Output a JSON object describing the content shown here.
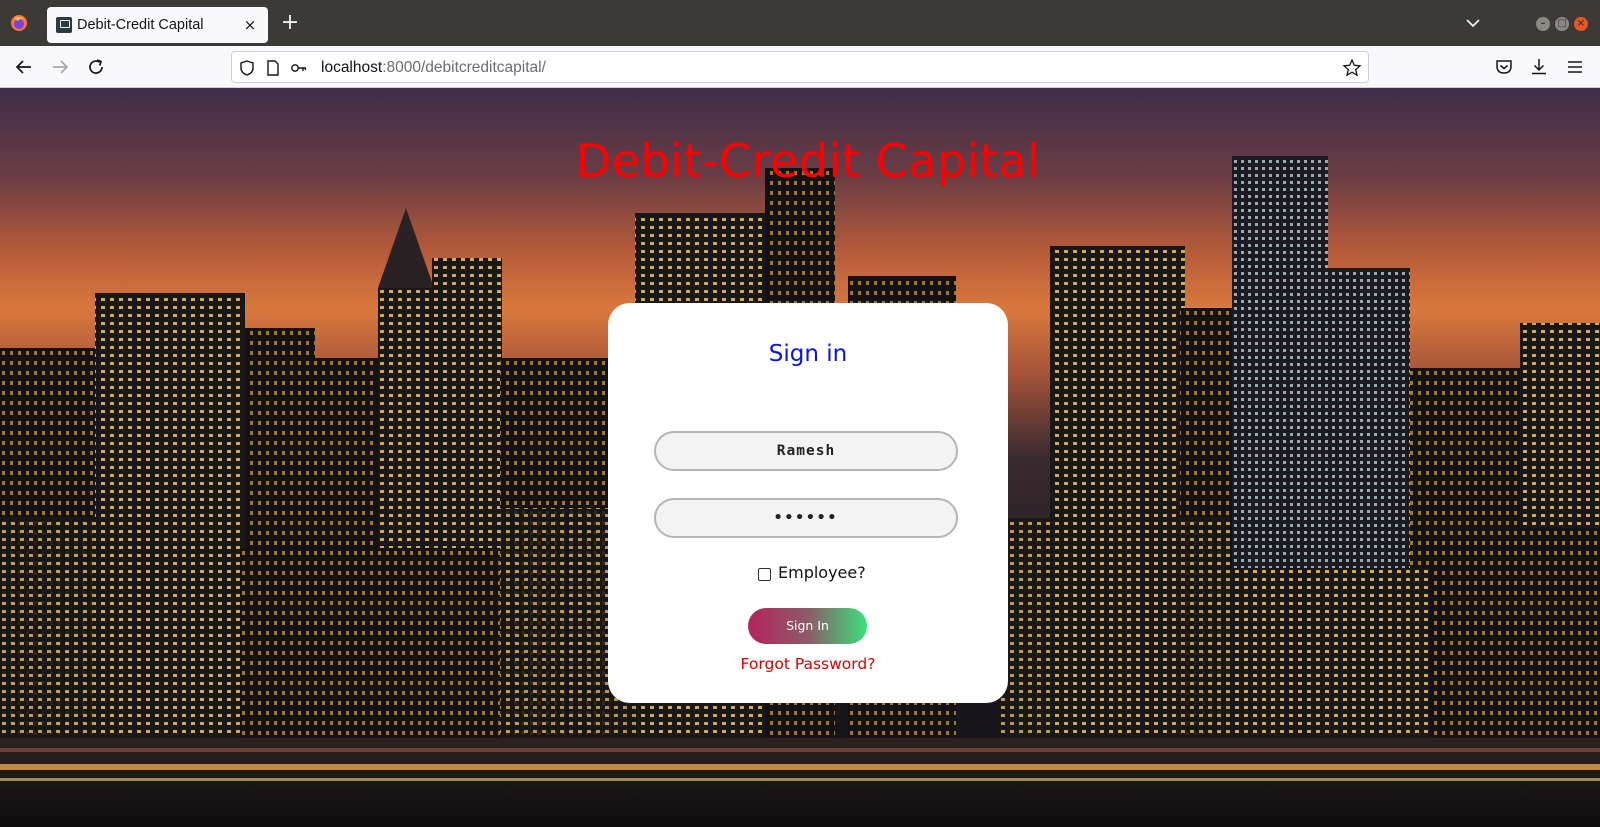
{
  "browser": {
    "tab_title": "Debit-Credit Capital",
    "url_host": "localhost",
    "url_path": ":8000/debitcreditcapital/",
    "tab_close": "×",
    "new_tab": "+"
  },
  "page": {
    "site_title": "Debit-Credit Capital",
    "signin_title": "Sign in",
    "username_value": "Ramesh",
    "password_value": "••••••",
    "employee_label": "Employee?",
    "employee_checked": false,
    "signin_button": "Sign In",
    "forgot_link": "Forgot Password?"
  },
  "colors": {
    "site_title": "#ff0000",
    "signin_title": "#0a14e6",
    "forgot_link": "#e00000",
    "button_gradient_start": "#b3245c",
    "button_gradient_end": "#3ae07c"
  }
}
